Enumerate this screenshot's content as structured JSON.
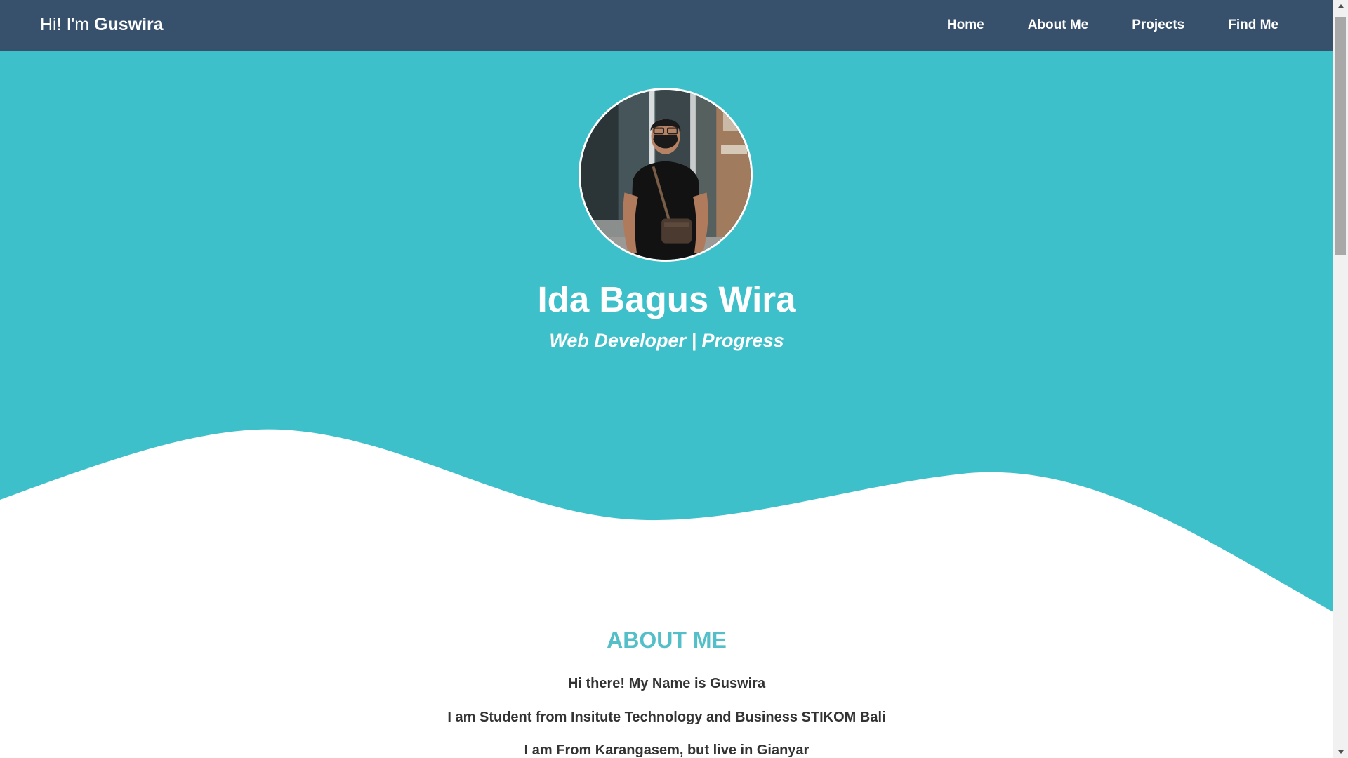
{
  "navbar": {
    "brand_prefix": "Hi! I'm ",
    "brand_name": "Guswira",
    "links": [
      {
        "label": "Home"
      },
      {
        "label": "About Me"
      },
      {
        "label": "Projects"
      },
      {
        "label": "Find Me"
      }
    ]
  },
  "hero": {
    "name": "Ida Bagus Wira",
    "role": "Web Developer | Progress"
  },
  "about": {
    "title": "ABOUT ME",
    "lines": [
      "Hi there! My Name is Guswira",
      "I am Student from Insitute Technology and Business STIKOM Bali",
      "I am From Karangasem, but live in Gianyar"
    ]
  },
  "colors": {
    "navbar": "#37506c",
    "hero_bg": "#3dc0ca",
    "about_title": "#55bfc9",
    "body_text": "#333333"
  },
  "icons": {
    "scroll_up": "triangle-up-icon",
    "scroll_down": "triangle-down-icon"
  }
}
